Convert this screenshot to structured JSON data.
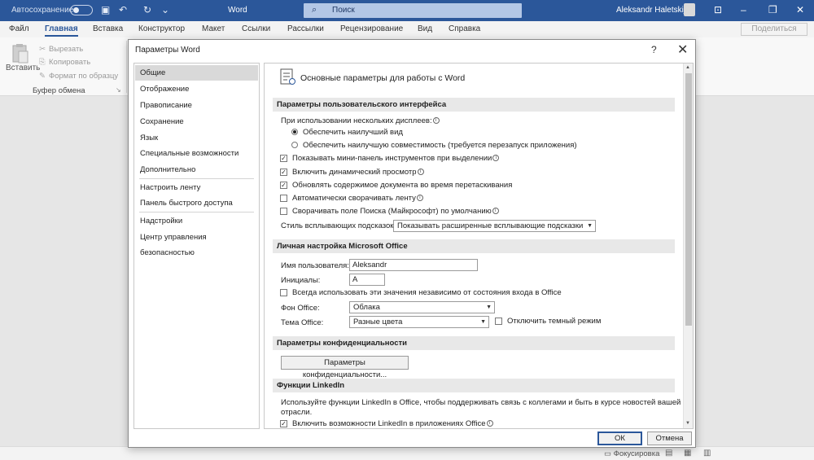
{
  "titlebar": {
    "autosave_label": "Автосохранение",
    "app_name": "Word",
    "search_placeholder": "Поиск",
    "user_name": "Aleksandr Haletskij",
    "accent_color": "#2b579a"
  },
  "ribbon_tabs": [
    "Файл",
    "Главная",
    "Вставка",
    "Конструктор",
    "Макет",
    "Ссылки",
    "Рассылки",
    "Рецензирование",
    "Вид",
    "Справка"
  ],
  "share_label": "Поделиться",
  "ribbon": {
    "paste_label": "Вставить",
    "cut_label": "Вырезать",
    "copy_label": "Копировать",
    "format_painter_label": "Формат по образцу",
    "group_label": "Буфер обмена"
  },
  "statusbar": {
    "focus_label": "Фокусировка"
  },
  "dialog": {
    "title": "Параметры Word",
    "help_icon": "question-icon",
    "close_icon": "close-icon",
    "nav": {
      "items": [
        {
          "label": "Общие",
          "selected": true
        },
        {
          "label": "Отображение"
        },
        {
          "label": "Правописание"
        },
        {
          "label": "Сохранение"
        },
        {
          "label": "Язык"
        },
        {
          "label": "Специальные возможности"
        },
        {
          "label": "Дополнительно"
        },
        {
          "label": "Настроить ленту"
        },
        {
          "label": "Панель быстрого доступа"
        },
        {
          "label": "Надстройки"
        },
        {
          "label": "Центр управления безопасностью"
        }
      ]
    },
    "content": {
      "title": "Основные параметры для работы с Word",
      "ui_section": {
        "header": "Параметры пользовательского интерфейса",
        "multi_display_label": "При использовании нескольких дисплеев:",
        "radio_best_view": "Обеспечить наилучший вид",
        "radio_compat": "Обеспечить наилучшую совместимость (требуется перезапуск приложения)",
        "cb_mini_toolbar": "Показывать мини-панель инструментов при выделении",
        "cb_live_preview": "Включить динамический просмотр",
        "cb_update_drag": "Обновлять содержимое документа во время перетаскивания",
        "cb_collapse_ribbon": "Автоматически сворачивать ленту",
        "cb_collapse_search": "Сворачивать поле Поиска (Майкрософт) по умолчанию",
        "tooltip_style_label": "Стиль всплывающих подсказок:",
        "tooltip_style_value": "Показывать расширенные всплывающие подсказки"
      },
      "personal_section": {
        "header": "Личная настройка Microsoft Office",
        "username_label": "Имя пользователя:",
        "username_value": "Aleksandr",
        "initials_label": "Инициалы:",
        "initials_value": "A",
        "cb_always_use": "Всегда использовать эти значения независимо от состояния входа в Office",
        "background_label": "Фон Office:",
        "background_value": "Облака",
        "theme_label": "Тема Office:",
        "theme_value": "Разные цвета",
        "cb_dark_mode": "Отключить темный режим"
      },
      "privacy_section": {
        "header": "Параметры конфиденциальности",
        "button_label": "Параметры конфиденциальности..."
      },
      "linkedin_section": {
        "header": "Функции LinkedIn",
        "description_line1": "Используйте функции LinkedIn в Office, чтобы поддерживать связь с коллегами и быть в курсе новостей вашей",
        "description_line2": "отрасли.",
        "cb_enable_linkedin": "Включить возможности LinkedIn в приложениях Office"
      }
    },
    "ok_label": "ОК",
    "cancel_label": "Отмена"
  }
}
